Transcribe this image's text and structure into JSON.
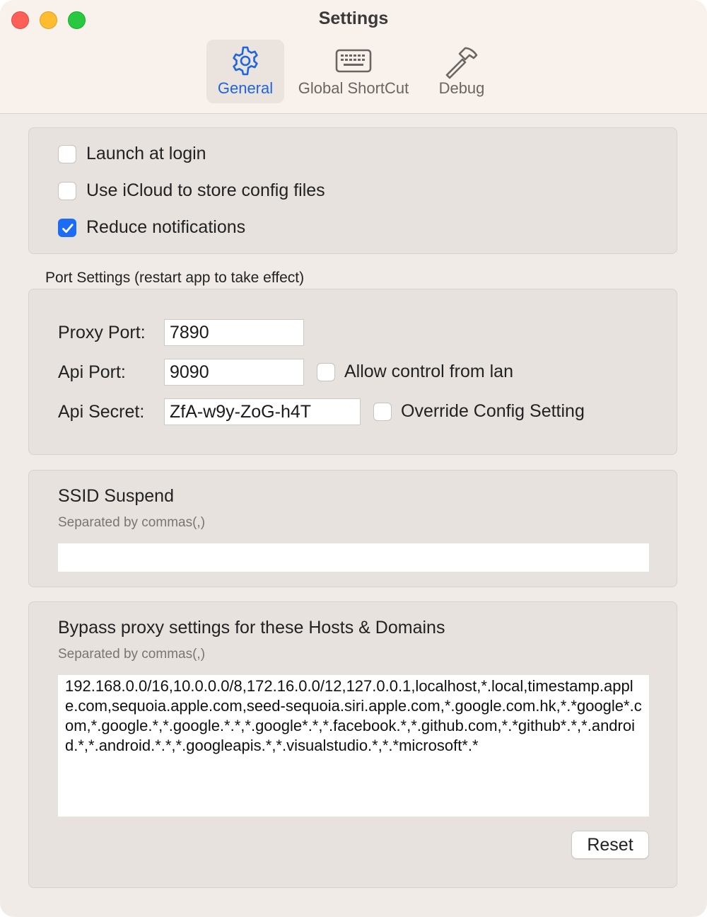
{
  "window": {
    "title": "Settings"
  },
  "tabs": [
    {
      "label": "General",
      "icon": "gear-icon",
      "active": true
    },
    {
      "label": "Global ShortCut",
      "icon": "keyboard-icon",
      "active": false
    },
    {
      "label": "Debug",
      "icon": "hammer-icon",
      "active": false
    }
  ],
  "general": {
    "launch_at_login": {
      "label": "Launch at login",
      "checked": false
    },
    "use_icloud": {
      "label": "Use iCloud to store config files",
      "checked": false
    },
    "reduce_notifications": {
      "label": "Reduce notifications",
      "checked": true
    }
  },
  "ports": {
    "section_label": "Port Settings (restart app to take effect)",
    "proxy_port_label": "Proxy Port:",
    "proxy_port_value": "7890",
    "api_port_label": "Api Port:",
    "api_port_value": "9090",
    "allow_lan_label": "Allow control from lan",
    "api_secret_label": "Api Secret:",
    "api_secret_value": "ZfA-w9y-ZoG-h4T",
    "override_label": "Override Config Setting"
  },
  "ssid": {
    "title": "SSID Suspend",
    "hint": "Separated by commas(,)",
    "value": ""
  },
  "bypass": {
    "title": "Bypass proxy settings for these Hosts & Domains",
    "hint": "Separated by commas(,)",
    "value": "192.168.0.0/16,10.0.0.0/8,172.16.0.0/12,127.0.0.1,localhost,*.local,timestamp.apple.com,sequoia.apple.com,seed-sequoia.siri.apple.com,*.google.com.hk,*.*google*.com,*.google.*,*.google.*.*,*.google*.*,*.facebook.*,*.github.com,*.*github*.*,*.android.*,*.android.*.*,*.googleapis.*,*.visualstudio.*,*.*microsoft*.*",
    "reset_label": "Reset"
  },
  "colors": {
    "accent": "#1f64e0",
    "checkbox_checked": "#1c6cf6",
    "background": "#f1ebe7",
    "panel": "#e8e2de"
  }
}
